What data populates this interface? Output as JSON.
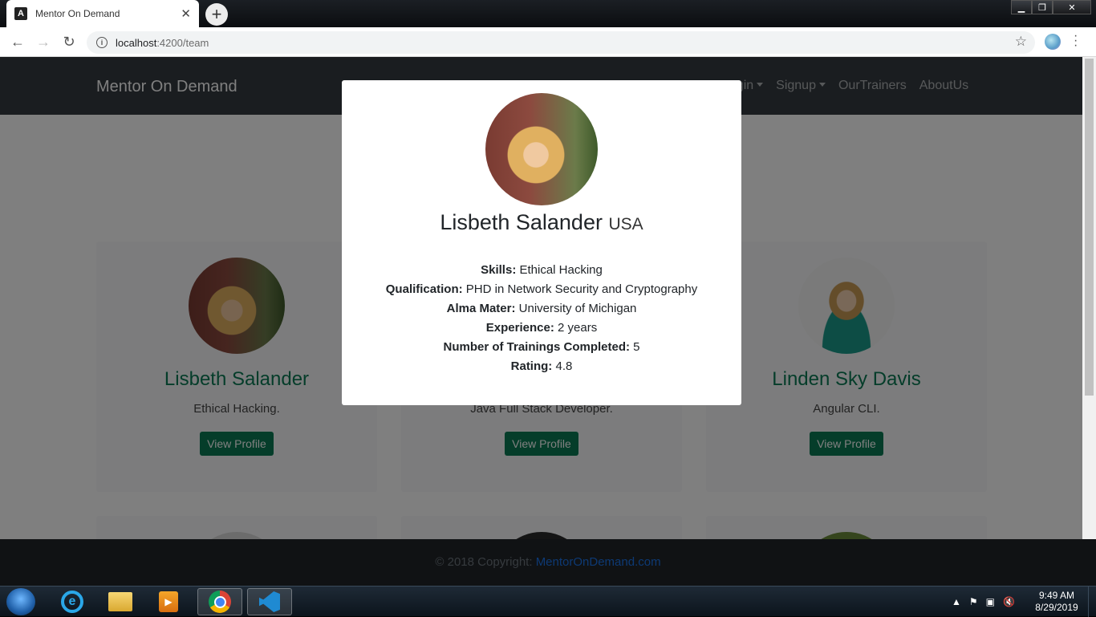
{
  "browser": {
    "tab_title": "Mentor On Demand",
    "favicon_letter": "A",
    "url_host": "localhost",
    "url_path": ":4200/team"
  },
  "site": {
    "brand": "Mentor On Demand",
    "nav": [
      {
        "label": "Login",
        "dropdown": true
      },
      {
        "label": "Signup",
        "dropdown": true
      },
      {
        "label": "OurTrainers",
        "dropdown": false
      },
      {
        "label": "AboutUs",
        "dropdown": false
      }
    ]
  },
  "cards": [
    {
      "name": "Lisbeth Salander",
      "role": "Ethical Hacking.",
      "button": "View Profile"
    },
    {
      "name": "",
      "role": "Java Full Stack Developer.",
      "button": "View Profile"
    },
    {
      "name": "Linden Sky Davis",
      "role": "Angular CLI.",
      "button": "View Profile"
    }
  ],
  "modal": {
    "name": "Lisbeth Salander",
    "country": "USA",
    "details": [
      {
        "label": "Skills:",
        "value": "Ethical Hacking"
      },
      {
        "label": "Qualification:",
        "value": "PHD in Network Security and Cryptography"
      },
      {
        "label": "Alma Mater:",
        "value": "University of Michigan"
      },
      {
        "label": "Experience:",
        "value": "2 years"
      },
      {
        "label": "Number of Trainings Completed:",
        "value": "5"
      },
      {
        "label": "Rating:",
        "value": "4.8"
      }
    ]
  },
  "footer": {
    "copyright": "© 2018 Copyright:",
    "link": "MentorOnDemand.com"
  },
  "taskbar": {
    "time": "9:49 AM",
    "date": "8/29/2019"
  }
}
